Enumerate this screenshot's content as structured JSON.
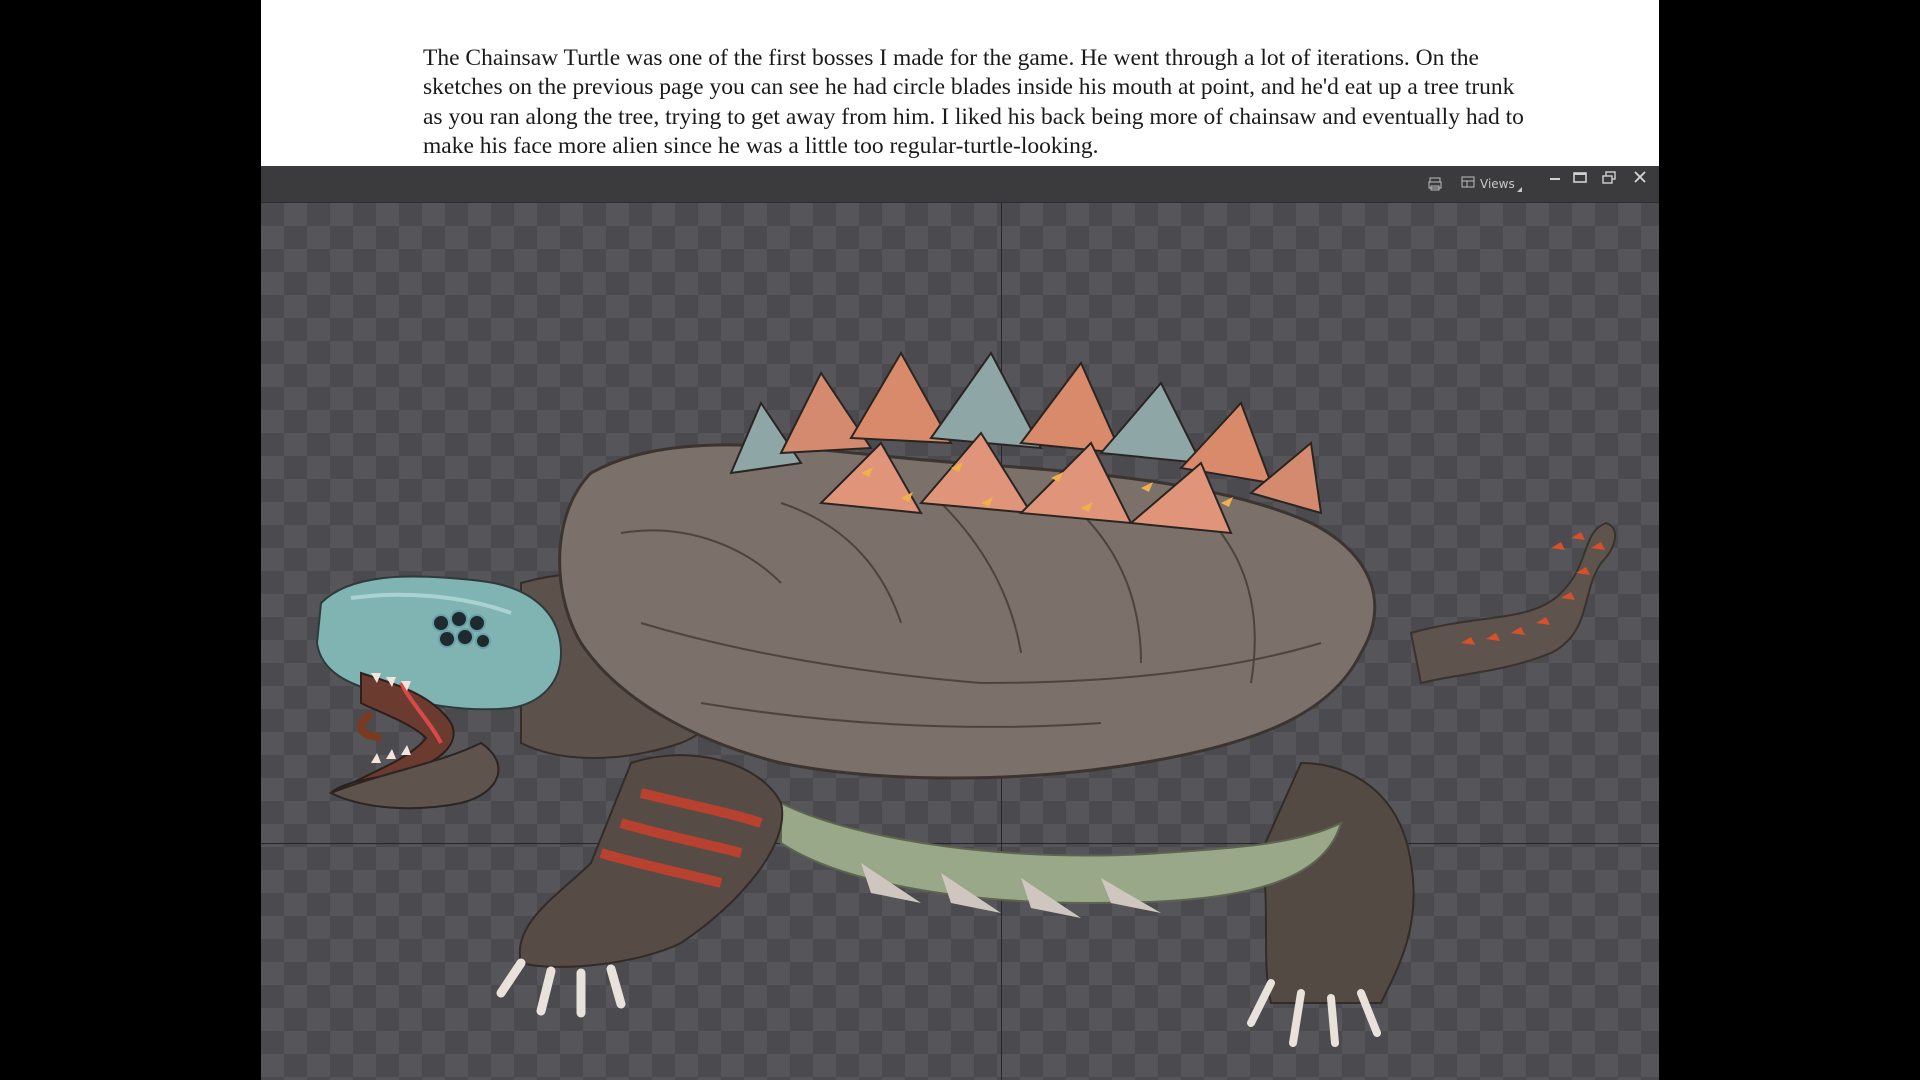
{
  "caption": {
    "text": "The Chainsaw Turtle was one of the first bosses I made for the game. He went through a lot of iterations. On the sketches on the previous page you can see he had circle blades inside his mouth at point, and he'd eat up a tree trunk as you ran along the tree, trying to get away from him. I liked his back being more of chainsaw and eventually had to make his face more alien since he was a little too regular-turtle-looking."
  },
  "viewer": {
    "toolbar": {
      "print_icon": "print-icon",
      "views_icon": "views-icon",
      "views_label": "Views",
      "minimize_icon": "minimize-icon",
      "maximize_icon": "maximize-icon",
      "restore_icon": "restore-icon",
      "close_icon": "close-icon"
    },
    "canvas": {
      "background": "transparency-checkerboard",
      "artwork": "chainsaw-turtle-illustration"
    }
  },
  "colors": {
    "page_background": "#000000",
    "paper": "#ffffff",
    "text": "#1a1a1a",
    "toolbar": "#3b3b3e",
    "checker_dark": "#4a4a4f",
    "checker_light": "#55555a",
    "shell": "#7a6e66",
    "spikes": "#d98a6a",
    "head": "#7fb8b8",
    "skin": "#5a4f49",
    "red_accent": "#c23a2a"
  }
}
